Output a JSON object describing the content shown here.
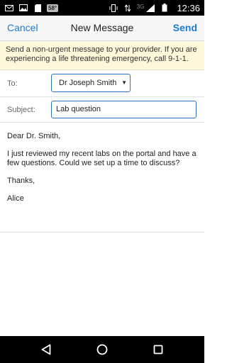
{
  "status_bar": {
    "time": "12:36",
    "badge": "58°",
    "network": "3G",
    "left_icons": [
      "mail-icon",
      "image-icon",
      "sd-card-icon",
      "temperature-badge"
    ],
    "right_icons": [
      "vibrate-icon",
      "data-arrows-icon",
      "signal-icon",
      "battery-icon"
    ]
  },
  "nav": {
    "cancel_label": "Cancel",
    "title": "New Message",
    "send_label": "Send",
    "accent_color": "#1a7ad6"
  },
  "notice": {
    "text": "Send a non-urgent message to your provider. If you are experiencing a life threatening emergency, call 9-1-1."
  },
  "form": {
    "to_label": "To:",
    "to_value": "Dr Joseph Smith",
    "subject_label": "Subject:",
    "subject_value": "Lab question"
  },
  "message": {
    "greeting": "Dear Dr. Smith,",
    "paragraph": "I just reviewed my recent labs on the portal and have a few questions. Could we set up a time to discuss?",
    "closing": "Thanks,",
    "signature": "Alice"
  }
}
